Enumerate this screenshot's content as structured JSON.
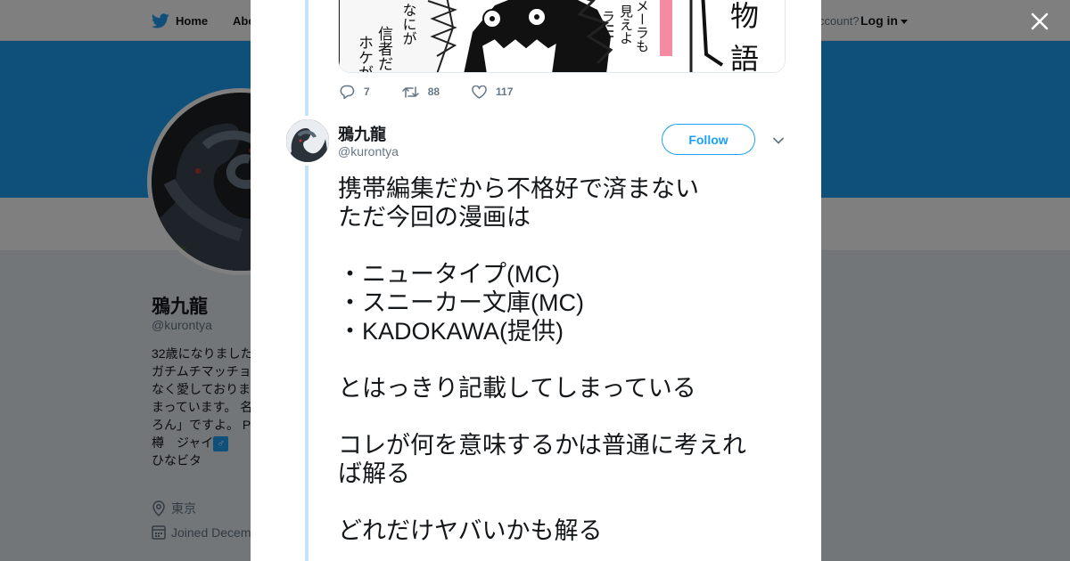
{
  "nav": {
    "home_label": "Home",
    "about_label": "Abo",
    "account_label": "ccount?",
    "login_label": "Log in"
  },
  "profile": {
    "name": "鴉九龍",
    "handle": "@kurontya",
    "bio_lines": [
      "32歳になりました",
      "ガチムチマッチョ",
      "なく愛しておりま",
      "まっています。 名",
      "ろん」ですよ。 P",
      "樽　ジャイ",
      "ひなビタ"
    ],
    "bio_symbol": "♂",
    "location": "東京",
    "joined": "Joined Decem"
  },
  "tweet_actions": {
    "replies": "7",
    "retweets": "88",
    "likes": "117"
  },
  "tweet": {
    "name": "鴉九龍",
    "handle": "@kurontya",
    "follow_label": "Follow",
    "lines": [
      "携帯編集だから不格好で済まない",
      "ただ今回の漫画は",
      "",
      "・ニュータイプ(MC)",
      "・スニーカー文庫(MC)",
      "・KADOKAWA(提供)",
      "",
      "とはっきり記載してしまっている",
      "",
      "コレが何を意味するかは普通に考えれ",
      "ば解る",
      "",
      "どれだけヤバいかも解る"
    ]
  },
  "manga": {
    "text_left": "信者だ",
    "text_left2": "ホケが",
    "text_left3": "なにが",
    "text_right": "メーラも",
    "text_right2": "見えよ",
    "text_right3": "ラ!!!",
    "text_big": "物",
    "text_big2": "語"
  },
  "colors": {
    "brand": "#1da1f2",
    "thread_line": "#c4e3f9",
    "muted": "#657786"
  }
}
